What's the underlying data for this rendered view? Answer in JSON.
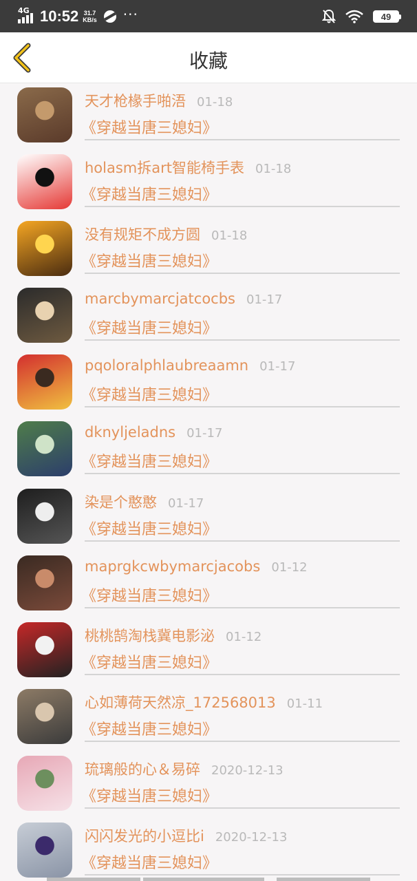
{
  "status_bar": {
    "network": "4G",
    "time": "10:52",
    "speed_value": "31.7",
    "speed_unit": "KB/s",
    "dots": "···",
    "battery": "49"
  },
  "header": {
    "title": "收藏"
  },
  "items": [
    {
      "name": "天才枪椽手啪浯",
      "date": "01-18",
      "book": "《穿越当唐三媳妇》",
      "colors": [
        "#8a6a4a",
        "#c49a6c",
        "#5a3a2a"
      ]
    },
    {
      "name": "holasm拆art智能椅手表",
      "date": "01-18",
      "book": "《穿越当唐三媳妇》",
      "colors": [
        "#ffffff",
        "#111111",
        "#e53935"
      ]
    },
    {
      "name": "没有规矩不成方圆",
      "date": "01-18",
      "book": "《穿越当唐三媳妇》",
      "colors": [
        "#f5a623",
        "#ffd54f",
        "#4a2c10"
      ]
    },
    {
      "name": "marcbymarcjatcocbs",
      "date": "01-17",
      "book": "《穿越当唐三媳妇》",
      "colors": [
        "#2b2b2b",
        "#e8d2b0",
        "#6e5a40"
      ]
    },
    {
      "name": "pqoloralphlaubreaamn",
      "date": "01-17",
      "book": "《穿越当唐三媳妇》",
      "colors": [
        "#d32f2f",
        "#3a2a20",
        "#f0c040"
      ]
    },
    {
      "name": "dknyljeladns",
      "date": "01-17",
      "book": "《穿越当唐三媳妇》",
      "colors": [
        "#4f7d4a",
        "#cfe3c8",
        "#2c3e6b"
      ]
    },
    {
      "name": "染是个憨憨",
      "date": "01-17",
      "book": "《穿越当唐三媳妇》",
      "colors": [
        "#1e1e1e",
        "#eeeeee",
        "#555555"
      ]
    },
    {
      "name": "maprgkcwbymarcjacobs",
      "date": "01-12",
      "book": "《穿越当唐三媳妇》",
      "colors": [
        "#3a2a22",
        "#c98b6a",
        "#7a4a3a"
      ]
    },
    {
      "name": "桃桃鹄淘栈冀电影泌",
      "date": "01-12",
      "book": "《穿越当唐三媳妇》",
      "colors": [
        "#c62828",
        "#f2f2f2",
        "#222222"
      ]
    },
    {
      "name": "心如薄荷天然凉_172568013",
      "date": "01-11",
      "book": "《穿越当唐三媳妇》",
      "colors": [
        "#8d7b66",
        "#d9c6ae",
        "#3b3b3b"
      ]
    },
    {
      "name": "琉璃般的心＆易碎",
      "date": "2020-12-13",
      "book": "《穿越当唐三媳妇》",
      "colors": [
        "#e7a8b6",
        "#6d8f5e",
        "#f6e1e7"
      ]
    },
    {
      "name": "闪闪发光的小逗比i",
      "date": "2020-12-13",
      "book": "《穿越当唐三媳妇》",
      "colors": [
        "#c7cdd6",
        "#3b2a6b",
        "#8a94a6"
      ]
    }
  ],
  "accent_color": "#e3935b"
}
